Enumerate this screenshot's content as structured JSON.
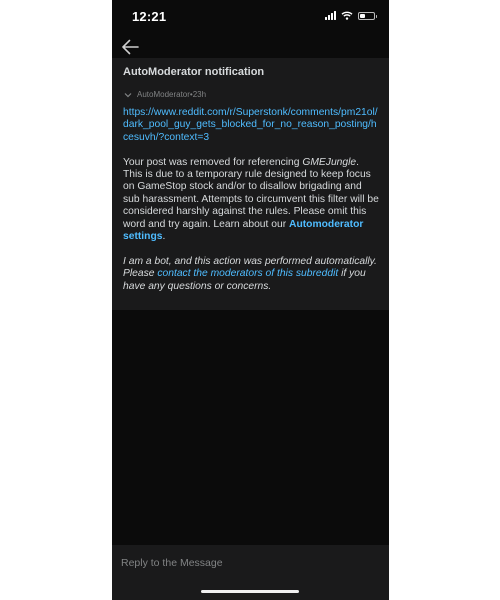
{
  "status_bar": {
    "time": "12:21",
    "battery_level": 0.35,
    "icons": [
      "signal-icon",
      "wifi-icon",
      "battery-icon"
    ]
  },
  "nav": {
    "back_icon": "back-arrow-icon"
  },
  "header": {
    "title": "AutoModerator notification"
  },
  "message": {
    "author": "AutoModerator",
    "separator": " • ",
    "age": "23h",
    "url": "https://www.reddit.com/r/Superstonk/comments/pm21ol/dark_pool_guy_gets_blocked_for_no_reason_posting/hcesuvh/?context=3",
    "p1_before": "Your post was removed for referencing ",
    "p1_term": "GMEJungle",
    "p1_after": ". This is due to a temporary rule designed to keep focus on GameStop stock and/or to disallow brigading and sub harassment. Attempts to circumvent this filter will be considered harshly against the rules. Please omit this word and try again. Learn about our ",
    "p1_link": "Automoderator settings",
    "p1_end": ".",
    "p2_before": "I am a bot, and this action was performed automatically. Please ",
    "p2_link": "contact the moderators of this subreddit",
    "p2_after": " if you have any questions or concerns."
  },
  "reply": {
    "placeholder": "Reply to the Message"
  },
  "colors": {
    "background": "#0b0b0b",
    "card": "#1a1a1b",
    "text": "#d7dadc",
    "muted": "#818384",
    "link": "#4fbcff"
  }
}
